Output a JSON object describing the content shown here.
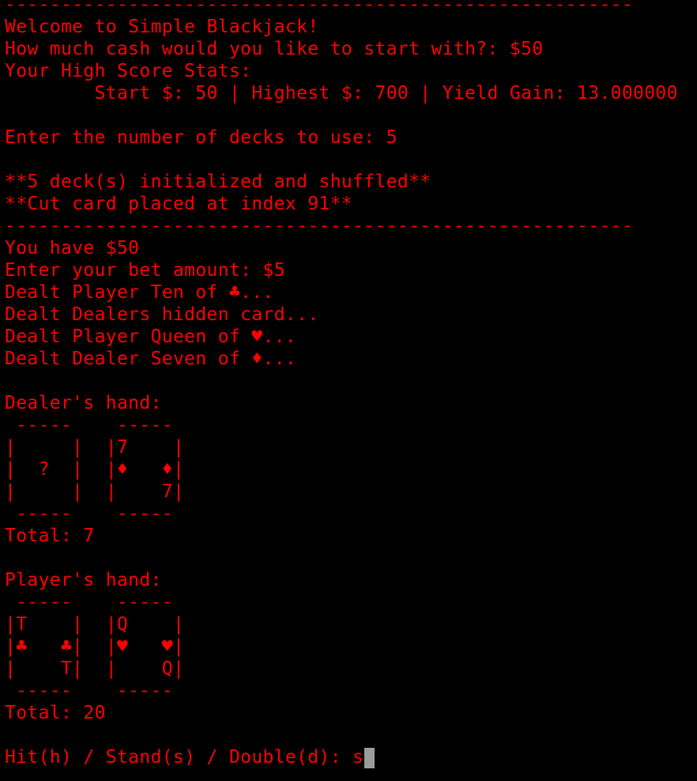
{
  "colors": {
    "background": "#000000",
    "foreground": "#ff0000",
    "cursor": "#9a9a9a"
  },
  "terminal": {
    "lines": [
      "--------------------------------------------------------",
      "Welcome to Simple Blackjack!",
      "How much cash would you like to start with?: $50",
      "Your High Score Stats:",
      "        Start $: 50 | Highest $: 700 | Yield Gain: 13.000000",
      "",
      "Enter the number of decks to use: 5",
      "",
      "**5 deck(s) initialized and shuffled**",
      "**Cut card placed at index 91**",
      "--------------------------------------------------------",
      "You have $50",
      "Enter your bet amount: $5",
      "Dealt Player Ten of ♣...",
      "Dealt Dealers hidden card...",
      "Dealt Player Queen of ♥...",
      "Dealt Dealer Seven of ♦...",
      "",
      "Dealer's hand:",
      " -----    -----",
      "|     |  |7    |",
      "|  ?  |  |♦   ♦|",
      "|     |  |    7|",
      " -----    -----",
      "Total: 7",
      "",
      "Player's hand:",
      " -----    -----",
      "|T    |  |Q    |",
      "|♣   ♣|  |♥   ♥|",
      "|    T|  |    Q|",
      " -----    -----",
      "Total: 20",
      ""
    ],
    "prompt": "Hit(h) / Stand(s) / Double(d): ",
    "input_value": "s"
  }
}
